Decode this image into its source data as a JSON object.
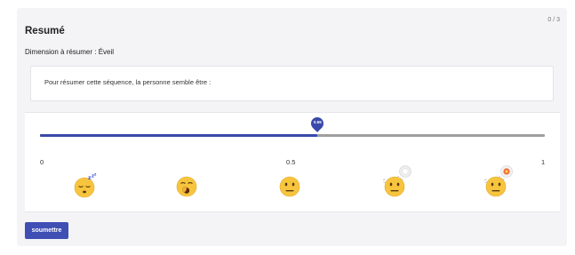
{
  "counter": "0 / 3",
  "title": "Resumé",
  "dimension": "Dimension à résumer : Éveil",
  "prompt": "Pour résumer cette séquence, la personne semble être :",
  "slider": {
    "min_label": "0",
    "mid_label": "0.5",
    "max_label": "1",
    "value": 0.55,
    "value_label": "0.55",
    "fill_color": "#3949ab",
    "track_color": "#9e9e9e"
  },
  "emojis": [
    "sleeping-face",
    "yawning-face",
    "neutral-face",
    "neutral-face-mild-explosion",
    "neutral-face-explosion"
  ],
  "submit_label": "soumettre",
  "accent_color": "#3f4fb4"
}
